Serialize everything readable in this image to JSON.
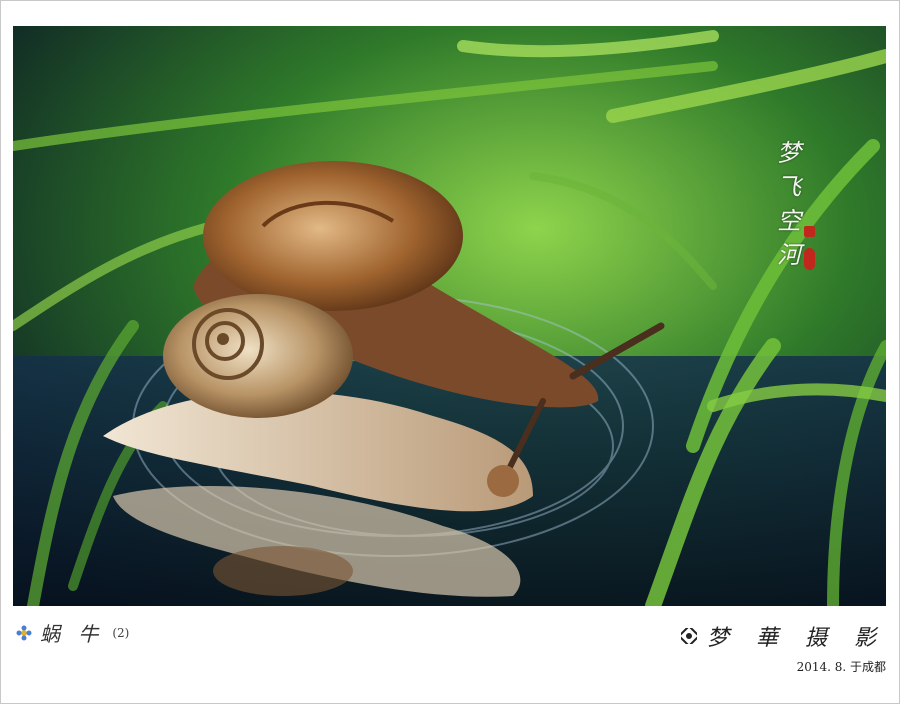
{
  "photo": {
    "subject": "snail-on-water-with-reflection",
    "calligraphy": "梦飞空河",
    "colors": {
      "grass": "#4fa82a",
      "water": "#0b1c2c",
      "shell": "#a8693a",
      "body": "#e6d6bf",
      "stamp": "#c0281e"
    }
  },
  "caption": {
    "title": "蜗 牛",
    "title_number": "(2)",
    "signature": "梦 華 摄 影",
    "date": "2014. 8. 于成都"
  }
}
